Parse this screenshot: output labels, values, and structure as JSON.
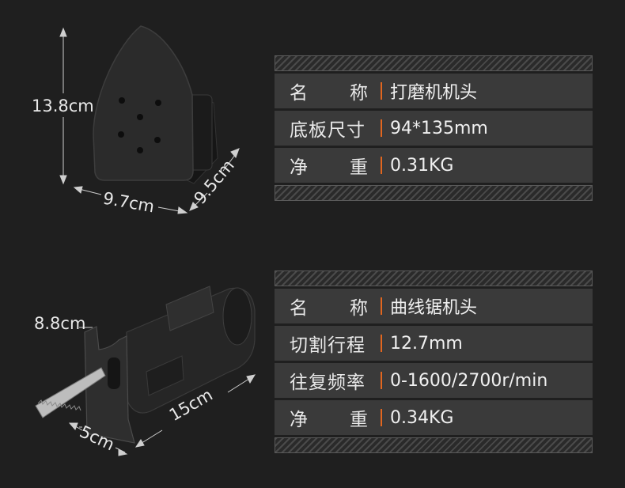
{
  "top": {
    "dims": {
      "height": "13.8cm",
      "width": "9.7cm",
      "depth": "9.5cm"
    },
    "rows": [
      {
        "label_a": "名",
        "label_b": "称",
        "value": "打磨机机头"
      },
      {
        "label_a": "底板尺寸",
        "label_b": "",
        "value": "94*135mm"
      },
      {
        "label_a": "净",
        "label_b": "重",
        "value": "0.31KG"
      }
    ]
  },
  "bottom": {
    "dims": {
      "height": "8.8cm",
      "length": "15cm",
      "width": "5cm"
    },
    "rows": [
      {
        "label_a": "名",
        "label_b": "称",
        "value": "曲线锯机头"
      },
      {
        "label_a": "切割行程",
        "label_b": "",
        "value": "12.7mm"
      },
      {
        "label_a": "往复频率",
        "label_b": "",
        "value": "0-1600/2700r/min"
      },
      {
        "label_a": "净",
        "label_b": "重",
        "value": "0.34KG"
      }
    ]
  },
  "colors": {
    "accent": "#e2661f",
    "row_bg": "#3a3a3a",
    "page_bg": "#1f1f1f"
  }
}
